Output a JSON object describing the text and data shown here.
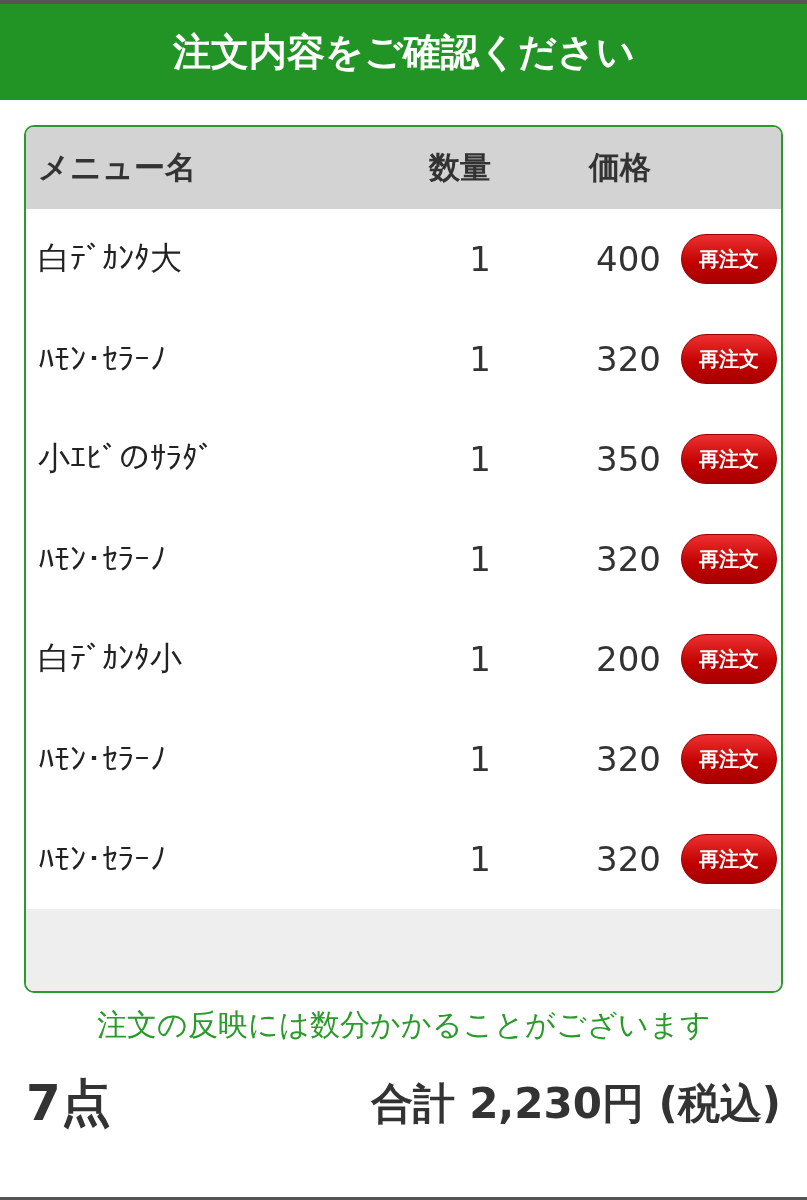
{
  "header": {
    "title": "注文内容をご確認ください"
  },
  "table": {
    "columns": [
      "メニュー名",
      "数量",
      "価格"
    ],
    "rows": [
      {
        "name": "白ﾃﾞｶﾝﾀ大",
        "qty": "1",
        "price": "400",
        "button": "再注文"
      },
      {
        "name": "ﾊﾓﾝ･ｾﾗｰﾉ",
        "qty": "1",
        "price": "320",
        "button": "再注文"
      },
      {
        "name": "小ｴﾋﾞのｻﾗﾀﾞ",
        "qty": "1",
        "price": "350",
        "button": "再注文"
      },
      {
        "name": "ﾊﾓﾝ･ｾﾗｰﾉ",
        "qty": "1",
        "price": "320",
        "button": "再注文"
      },
      {
        "name": "白ﾃﾞｶﾝﾀ小",
        "qty": "1",
        "price": "200",
        "button": "再注文"
      },
      {
        "name": "ﾊﾓﾝ･ｾﾗｰﾉ",
        "qty": "1",
        "price": "320",
        "button": "再注文"
      },
      {
        "name": "ﾊﾓﾝ･ｾﾗｰﾉ",
        "qty": "1",
        "price": "320",
        "button": "再注文"
      }
    ]
  },
  "notice": "注文の反映には数分かかることがございます",
  "footer": {
    "count": "7点",
    "total": "合計 2,230円 (税込)"
  }
}
